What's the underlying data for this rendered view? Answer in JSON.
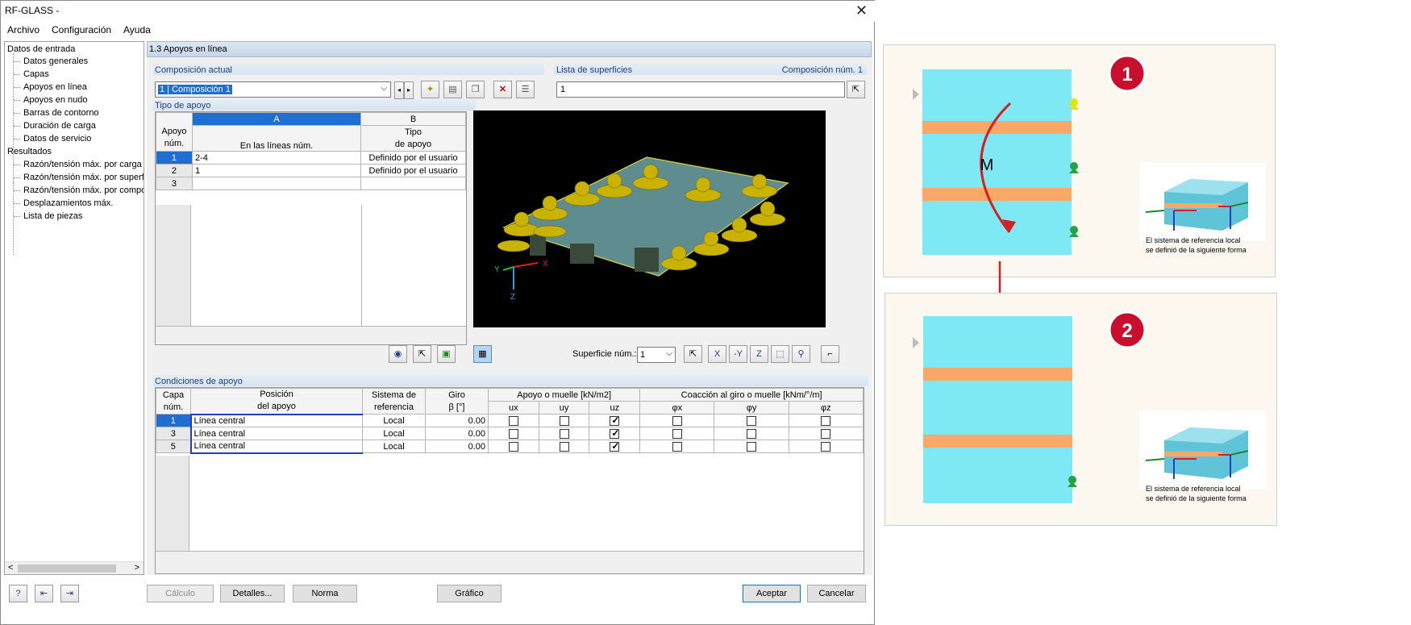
{
  "window": {
    "title": "RF-GLASS -",
    "close": "✕"
  },
  "menu": [
    "Archivo",
    "Configuración",
    "Ayuda"
  ],
  "nav": {
    "input_root": "Datos de entrada",
    "input_items": [
      "Datos generales",
      "Capas",
      "Apoyos en línea",
      "Apoyos en nudo",
      "Barras de contorno",
      "Duración de carga",
      "Datos de servicio"
    ],
    "results_root": "Resultados",
    "results_items": [
      "Razón/tensión máx. por carga",
      "Razón/tensión máx. por superf",
      "Razón/tensión máx. por compo",
      "Desplazamientos máx.",
      "Lista de piezas"
    ],
    "scroll_left": "<",
    "scroll_right": ">"
  },
  "section_title": "1.3 Apoyos en línea",
  "composicion": {
    "label": "Composición actual",
    "value": "1 | Composición 1"
  },
  "superficies": {
    "label": "Lista de superficies",
    "right_label": "Composición núm. 1",
    "value": "1"
  },
  "tipo_apoyo": {
    "label": "Tipo de apoyo",
    "col_a": "A",
    "col_b": "B",
    "h_apoyo1": "Apoyo",
    "h_apoyo2": "núm.",
    "h_lineas": "En las líneas núm.",
    "h_tipo1": "Tipo",
    "h_tipo2": "de apoyo",
    "rows": [
      {
        "num": "1",
        "lineas": "2-4",
        "tipo": "Definido por el usuario"
      },
      {
        "num": "2",
        "lineas": "1",
        "tipo": "Definido por el usuario"
      },
      {
        "num": "3",
        "lineas": "",
        "tipo": ""
      }
    ]
  },
  "view": {
    "superficie_label": "Superficie núm.:",
    "superficie_value": "1",
    "axis_x": "X",
    "axis_y": "Y",
    "axis_z": "Z"
  },
  "condiciones": {
    "label": "Condiciones de apoyo",
    "h_capa1": "Capa",
    "h_capa2": "núm.",
    "h_pos1": "Posición",
    "h_pos2": "del apoyo",
    "h_sis1": "Sistema de",
    "h_sis2": "referencia",
    "h_giro1": "Giro",
    "h_giro2": "β [°]",
    "h_muelle": "Apoyo o muelle [kN/m2]",
    "h_coaccion": "Coacción al giro o muelle [kNm/°/m]",
    "h_ux": "ux",
    "h_uy": "uy",
    "h_uz": "uz",
    "h_px": "φx",
    "h_py": "φy",
    "h_pz": "φz",
    "rows": [
      {
        "capa": "1",
        "pos": "Línea central",
        "sis": "Local",
        "giro": "0.00",
        "uz": true
      },
      {
        "capa": "3",
        "pos": "Línea central",
        "sis": "Local",
        "giro": "0.00",
        "uz": true
      },
      {
        "capa": "5",
        "pos": "Línea central",
        "sis": "Local",
        "giro": "0.00",
        "uz": true
      }
    ]
  },
  "buttons": {
    "calculo": "Cálculo",
    "detalles": "Detalles...",
    "norma": "Norma",
    "grafico": "Gráfico",
    "aceptar": "Aceptar",
    "cancelar": "Cancelar"
  },
  "panel1": {
    "badge": "1",
    "moment": "M",
    "caption1": "El sistema de referencia local",
    "caption2": "se definió de la siguiente forma"
  },
  "panel2": {
    "badge": "2",
    "caption1": "El sistema de referencia local",
    "caption2": "se definió de la siguiente forma"
  },
  "colors": {
    "glass": "#7fe8f5",
    "layer": "#f9a86a",
    "support": "#33aa44",
    "arrow": "#d42020"
  }
}
